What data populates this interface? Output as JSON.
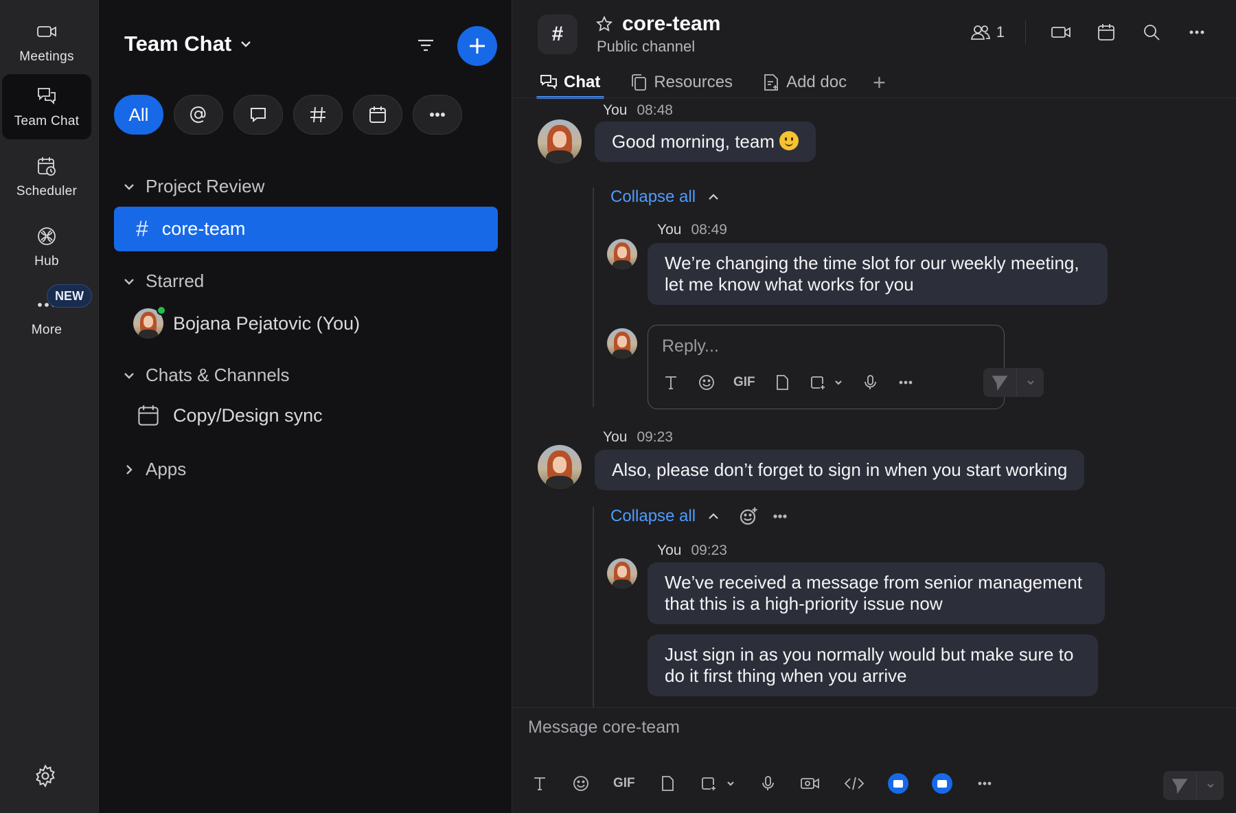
{
  "rail": {
    "items": [
      {
        "label": "Meetings"
      },
      {
        "label": "Team Chat"
      },
      {
        "label": "Scheduler"
      },
      {
        "label": "Hub"
      },
      {
        "label": "More"
      }
    ],
    "new_badge": "NEW"
  },
  "sidebar": {
    "title": "Team Chat",
    "filters": [
      {
        "label": "All",
        "active": true
      },
      {
        "icon": "mention-icon"
      },
      {
        "icon": "chat-bubble-icon"
      },
      {
        "icon": "hash-icon"
      },
      {
        "icon": "calendar-icon"
      },
      {
        "icon": "more-icon"
      }
    ],
    "sections": {
      "project_review": "Project Review",
      "starred": "Starred",
      "chats_channels": "Chats & Channels",
      "apps": "Apps"
    },
    "active_channel": "core-team",
    "starred_user": "Bojana Pejatovic (You)",
    "chat_item": "Copy/Design sync"
  },
  "channel": {
    "name": "core-team",
    "subtitle": "Public channel",
    "member_count": "1",
    "tabs": [
      {
        "label": "Chat",
        "active": true
      },
      {
        "label": "Resources"
      },
      {
        "label": "Add doc"
      }
    ]
  },
  "messages": {
    "m1": {
      "author": "You",
      "time": "08:48",
      "text": "Good morning, team"
    },
    "collapse_label": "Collapse all",
    "r1": {
      "author": "You",
      "time": "08:49",
      "line1": "We’re changing the time slot for our weekly meeting,",
      "line2": "let me know what works for you"
    },
    "reply_placeholder": "Reply...",
    "m2": {
      "author": "You",
      "time": "09:23",
      "text": "Also, please don’t forget to sign in when you start working"
    },
    "r2": {
      "author": "You",
      "time": "09:23",
      "line1": "We’ve received a message from senior management",
      "line2": "that this is a high-priority issue now"
    },
    "r3": {
      "line1": "Just sign in as you normally would but make sure to",
      "line2": "do it first thing when you arrive"
    }
  },
  "composer": {
    "placeholder": "Message core-team",
    "gif_label": "GIF"
  },
  "colors": {
    "accent": "#1769e8",
    "link": "#4f9bff",
    "bubble": "#2c2f3a",
    "online": "#1fbf4a"
  }
}
